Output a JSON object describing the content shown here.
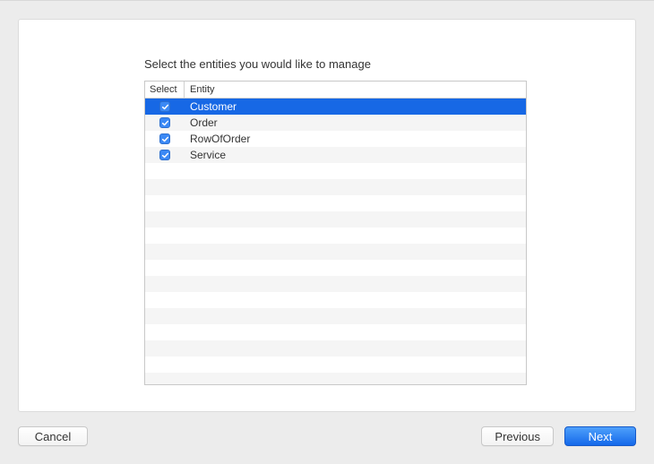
{
  "title": "Select the entities you would like to manage",
  "columns": {
    "select": "Select",
    "entity": "Entity"
  },
  "entities": [
    {
      "checked": true,
      "name": "Customer",
      "selected": true
    },
    {
      "checked": true,
      "name": "Order",
      "selected": false
    },
    {
      "checked": true,
      "name": "RowOfOrder",
      "selected": false
    },
    {
      "checked": true,
      "name": "Service",
      "selected": false
    }
  ],
  "buttons": {
    "cancel": "Cancel",
    "previous": "Previous",
    "next": "Next"
  },
  "visibleRowCount": 18
}
